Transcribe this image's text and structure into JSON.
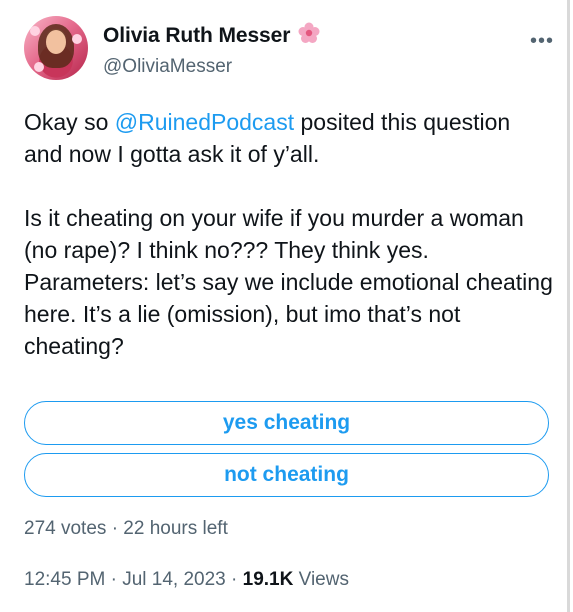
{
  "author": {
    "display_name": "Olivia Ruth Messer",
    "badge_icon": "flower-emoji",
    "handle": "@OliviaMesser"
  },
  "tweet": {
    "para1_before": "Okay so ",
    "para1_mention": "@RuinedPodcast",
    "para1_after": " posited this question and now I gotta ask it of y’all.",
    "para2": "Is it cheating on your wife if you murder a woman (no rape)? I think no??? They think yes. Parameters: let’s say we include emotional cheating here. It’s a lie (omission), but imo that’s not cheating?"
  },
  "poll": {
    "options": [
      "yes cheating",
      "not cheating"
    ],
    "votes": "274 votes",
    "separator": "·",
    "time_left": "22 hours left"
  },
  "meta": {
    "time": "12:45 PM",
    "dot1": "·",
    "date": "Jul 14, 2023",
    "dot2": "·",
    "views_count": "19.1K",
    "views_label": "Views"
  },
  "colors": {
    "accent": "#1d9bf0",
    "muted": "#536471",
    "text": "#0f1419"
  }
}
